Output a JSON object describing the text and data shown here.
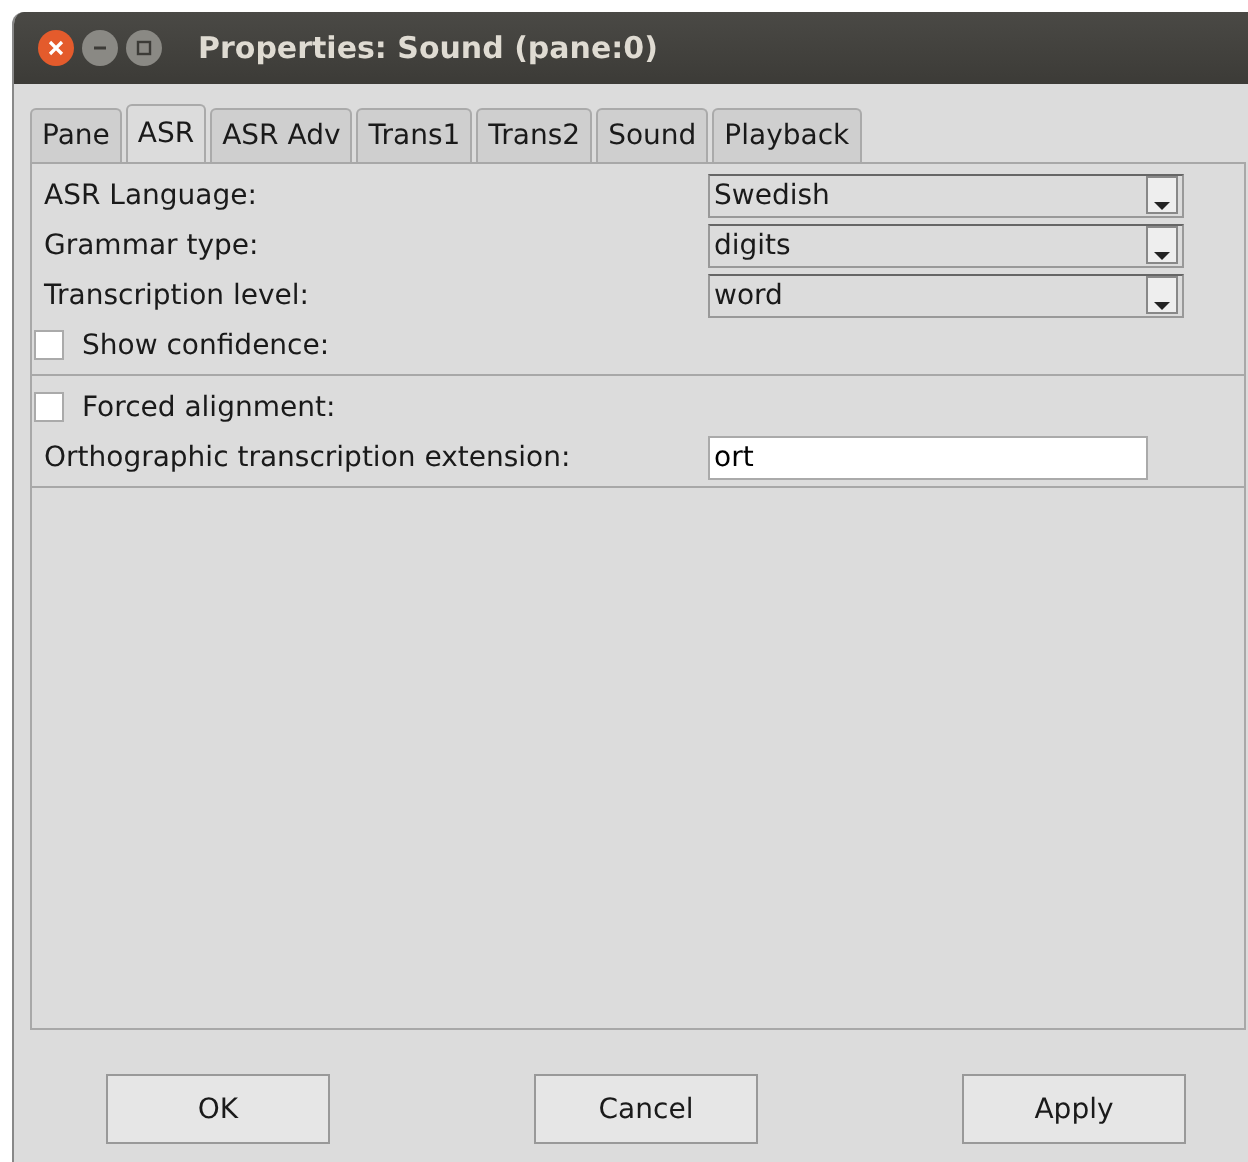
{
  "window": {
    "title": "Properties: Sound (pane:0)"
  },
  "tabs": [
    {
      "label": "Pane",
      "selected": false
    },
    {
      "label": "ASR",
      "selected": true
    },
    {
      "label": "ASR Adv",
      "selected": false
    },
    {
      "label": "Trans1",
      "selected": false
    },
    {
      "label": "Trans2",
      "selected": false
    },
    {
      "label": "Sound",
      "selected": false
    },
    {
      "label": "Playback",
      "selected": false
    }
  ],
  "sections": [
    {
      "rows": [
        {
          "kind": "combo",
          "label": "ASR Language:",
          "value": "Swedish"
        },
        {
          "kind": "combo",
          "label": "Grammar type:",
          "value": "digits"
        },
        {
          "kind": "combo",
          "label": "Transcription level:",
          "value": "word"
        },
        {
          "kind": "checkbox",
          "label": "Show confidence:",
          "checked": false
        }
      ]
    },
    {
      "rows": [
        {
          "kind": "checkbox",
          "label": "Forced alignment:",
          "checked": false
        },
        {
          "kind": "text",
          "label": "Orthographic transcription extension:",
          "value": "ort"
        }
      ]
    }
  ],
  "buttons": [
    "OK",
    "Cancel",
    "Apply"
  ]
}
